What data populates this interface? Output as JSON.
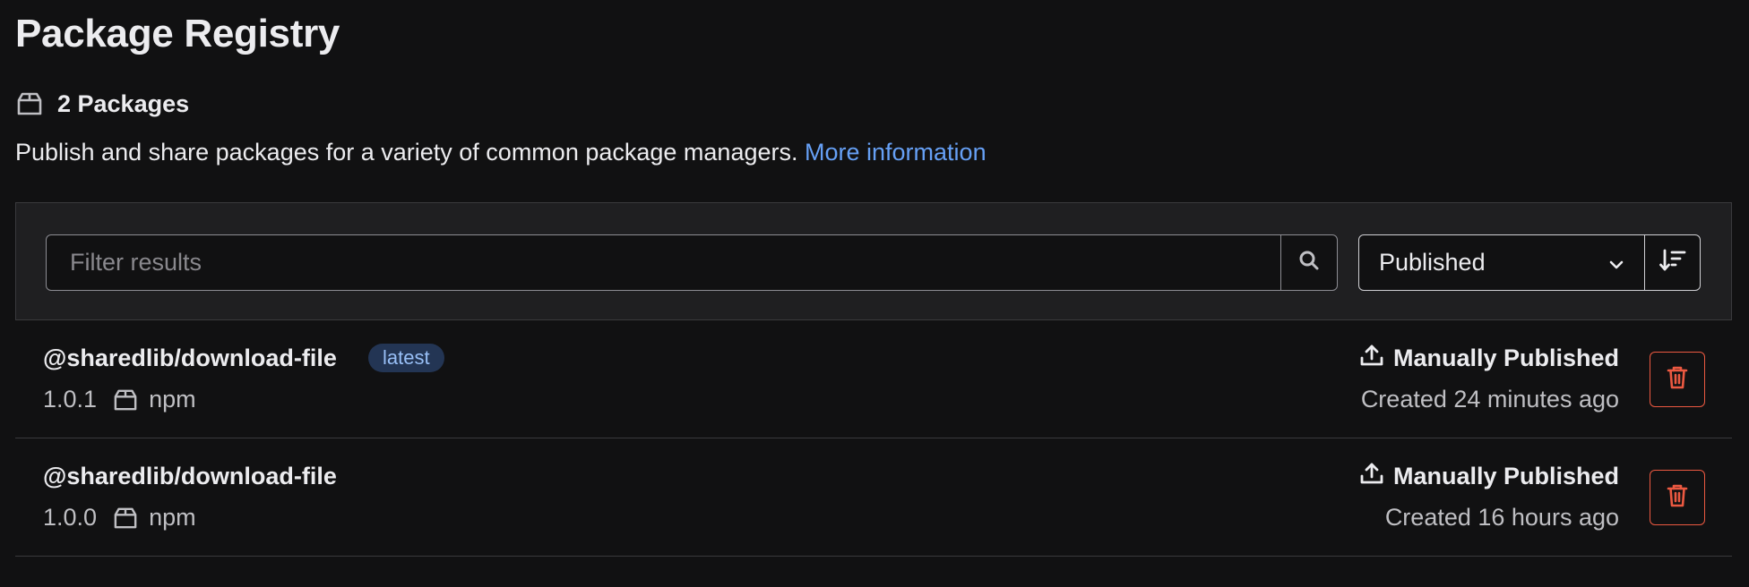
{
  "header": {
    "title": "Package Registry",
    "package_count_label": "2 Packages",
    "description": "Publish and share packages for a variety of common package managers.",
    "more_info_link": "More information"
  },
  "filter": {
    "search_placeholder": "Filter results",
    "sort_selected": "Published"
  },
  "packages": [
    {
      "name": "@sharedlib/download-file",
      "badge": "latest",
      "version": "1.0.1",
      "type": "npm",
      "publish_status": "Manually Published",
      "created": "Created 24 minutes ago"
    },
    {
      "name": "@sharedlib/download-file",
      "badge": "",
      "version": "1.0.0",
      "type": "npm",
      "publish_status": "Manually Published",
      "created": "Created 16 hours ago"
    }
  ],
  "colors": {
    "background": "#111112",
    "link": "#66a0f5",
    "badge_bg": "#233554",
    "badge_text": "#98bff6",
    "danger": "#ec5941"
  },
  "icons": {
    "package": "package-icon",
    "search": "search-icon",
    "chevron": "chevron-down-icon",
    "sort": "sort-lowest-icon",
    "upload": "upload-icon",
    "delete": "trash-icon"
  }
}
